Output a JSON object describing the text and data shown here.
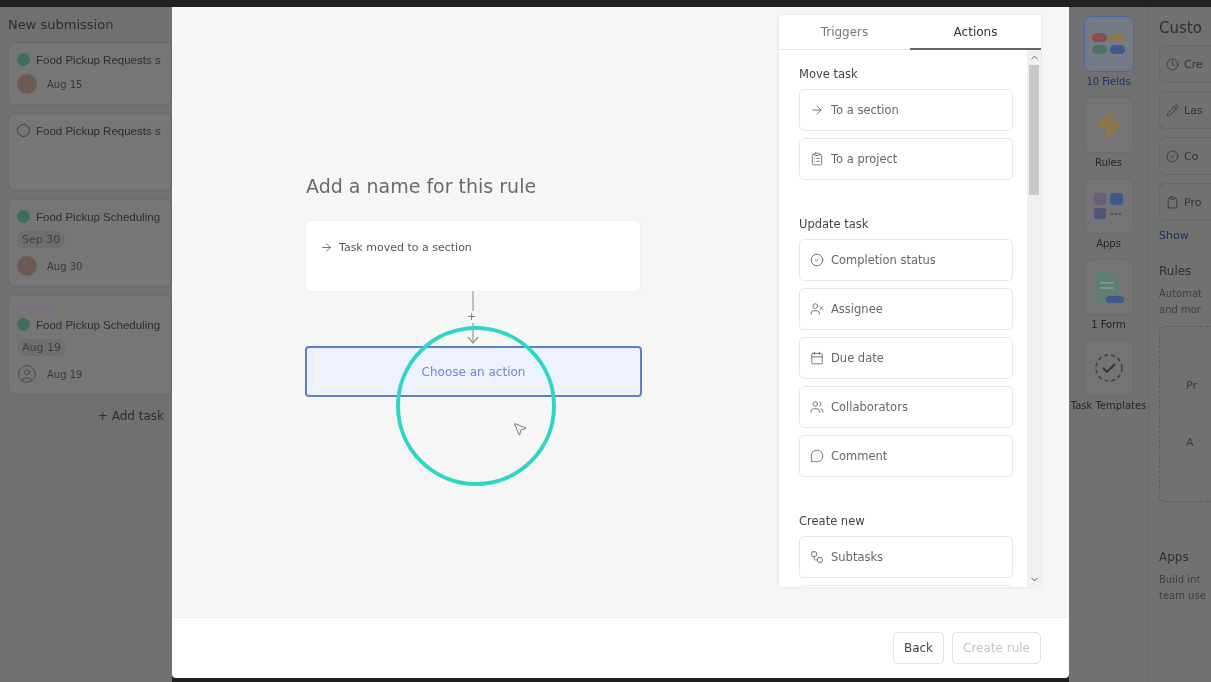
{
  "board": {
    "column_title": "New submission",
    "cards": [
      {
        "title": "Food Pickup Requests s",
        "completed": true,
        "photo": true,
        "date": "Aug 15"
      },
      {
        "title": "Food Pickup Requests s",
        "completed": false
      },
      {
        "title": "Food Pickup Scheduling",
        "completed": true,
        "tag": "Sep 30",
        "photo": true,
        "date": "Aug 30"
      },
      {
        "title": "Food Pickup Scheduling",
        "completed": true,
        "color": "#7a6a8c",
        "tag": "Aug 19",
        "photo": false,
        "date": "Aug 19"
      }
    ],
    "add_task": "+ Add task"
  },
  "rule_dialog": {
    "name_placeholder": "Add a name for this rule",
    "trigger": {
      "label": "Task moved to a section"
    },
    "connector": {
      "symbol": "+"
    },
    "action_slot": {
      "label": "Choose an action",
      "selected": true
    },
    "tabs": [
      {
        "label": "Triggers",
        "selected": false
      },
      {
        "label": "Actions",
        "selected": true
      }
    ],
    "sections": [
      {
        "title": "Move task",
        "options": [
          {
            "kind": "arrow",
            "label": "To a section"
          },
          {
            "kind": "clipboard",
            "label": "To a project"
          }
        ]
      },
      {
        "title": "Update task",
        "options": [
          {
            "kind": "check",
            "label": "Completion status"
          },
          {
            "kind": "assignee",
            "label": "Assignee"
          },
          {
            "kind": "calendar",
            "label": "Due date"
          },
          {
            "kind": "people",
            "label": "Collaborators"
          },
          {
            "kind": "comment",
            "label": "Comment"
          }
        ]
      },
      {
        "title": "Create new",
        "options": [
          {
            "kind": "subtasks",
            "label": "Subtasks"
          }
        ]
      }
    ],
    "buttons": [
      {
        "label": "Back",
        "disabled": false
      },
      {
        "label": "Create rule",
        "disabled": true
      }
    ]
  },
  "customize": {
    "tiles": [
      {
        "kind": "fields",
        "label": "10 Fields",
        "selected": true
      },
      {
        "kind": "rules",
        "label": "Rules",
        "selected": false
      },
      {
        "kind": "apps",
        "label": "Apps",
        "selected": false
      },
      {
        "kind": "form",
        "label": "1 Form",
        "selected": false
      },
      {
        "kind": "templates",
        "label": "Task Templates",
        "selected": false
      }
    ],
    "title": "Custo",
    "fields": [
      {
        "kind": "clock",
        "label": "Cre"
      },
      {
        "kind": "pencil",
        "label": "Las"
      },
      {
        "kind": "check",
        "label": "Co"
      },
      {
        "kind": "clipboard",
        "label": "Pro"
      }
    ],
    "show_more": "Show",
    "rules_heading": "Rules",
    "rules_text": [
      "Automat",
      "and mor"
    ],
    "rules_buttons": [
      "Pr",
      "A"
    ],
    "apps_heading": "Apps",
    "apps_text": [
      "Build int",
      "team use"
    ]
  }
}
